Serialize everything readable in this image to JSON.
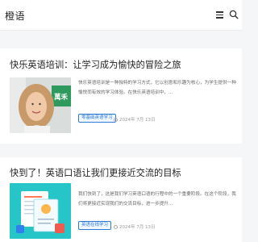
{
  "header": {
    "site_name": "橙语"
  },
  "articles": [
    {
      "title": "快乐英语培训：让学习成为愉快的冒险之旅",
      "excerpt": "快乐英语培训是一种独特的学习方式，它以创意和乐趣为核心，为学生提供一种愉悦而有效的学习体验。在快乐英语培训中，...",
      "tag": "零基础英语学习",
      "date": "2024年 7月 13日",
      "thumb_sign": "萬禾"
    },
    {
      "title": "快到了！英语口语让我们更接近交流的目标",
      "excerpt": "我们快到了，这是我们学习英语口语的行程中的一个重要阶段。在这个阶段，我们将更接近实现我们的交流目标，进一步提升...",
      "tag": "英语在线学习",
      "date": "2024年 7月 13日"
    }
  ],
  "colors": {
    "accent": "#2b7bd8",
    "page_bg": "#f5f6f7"
  }
}
